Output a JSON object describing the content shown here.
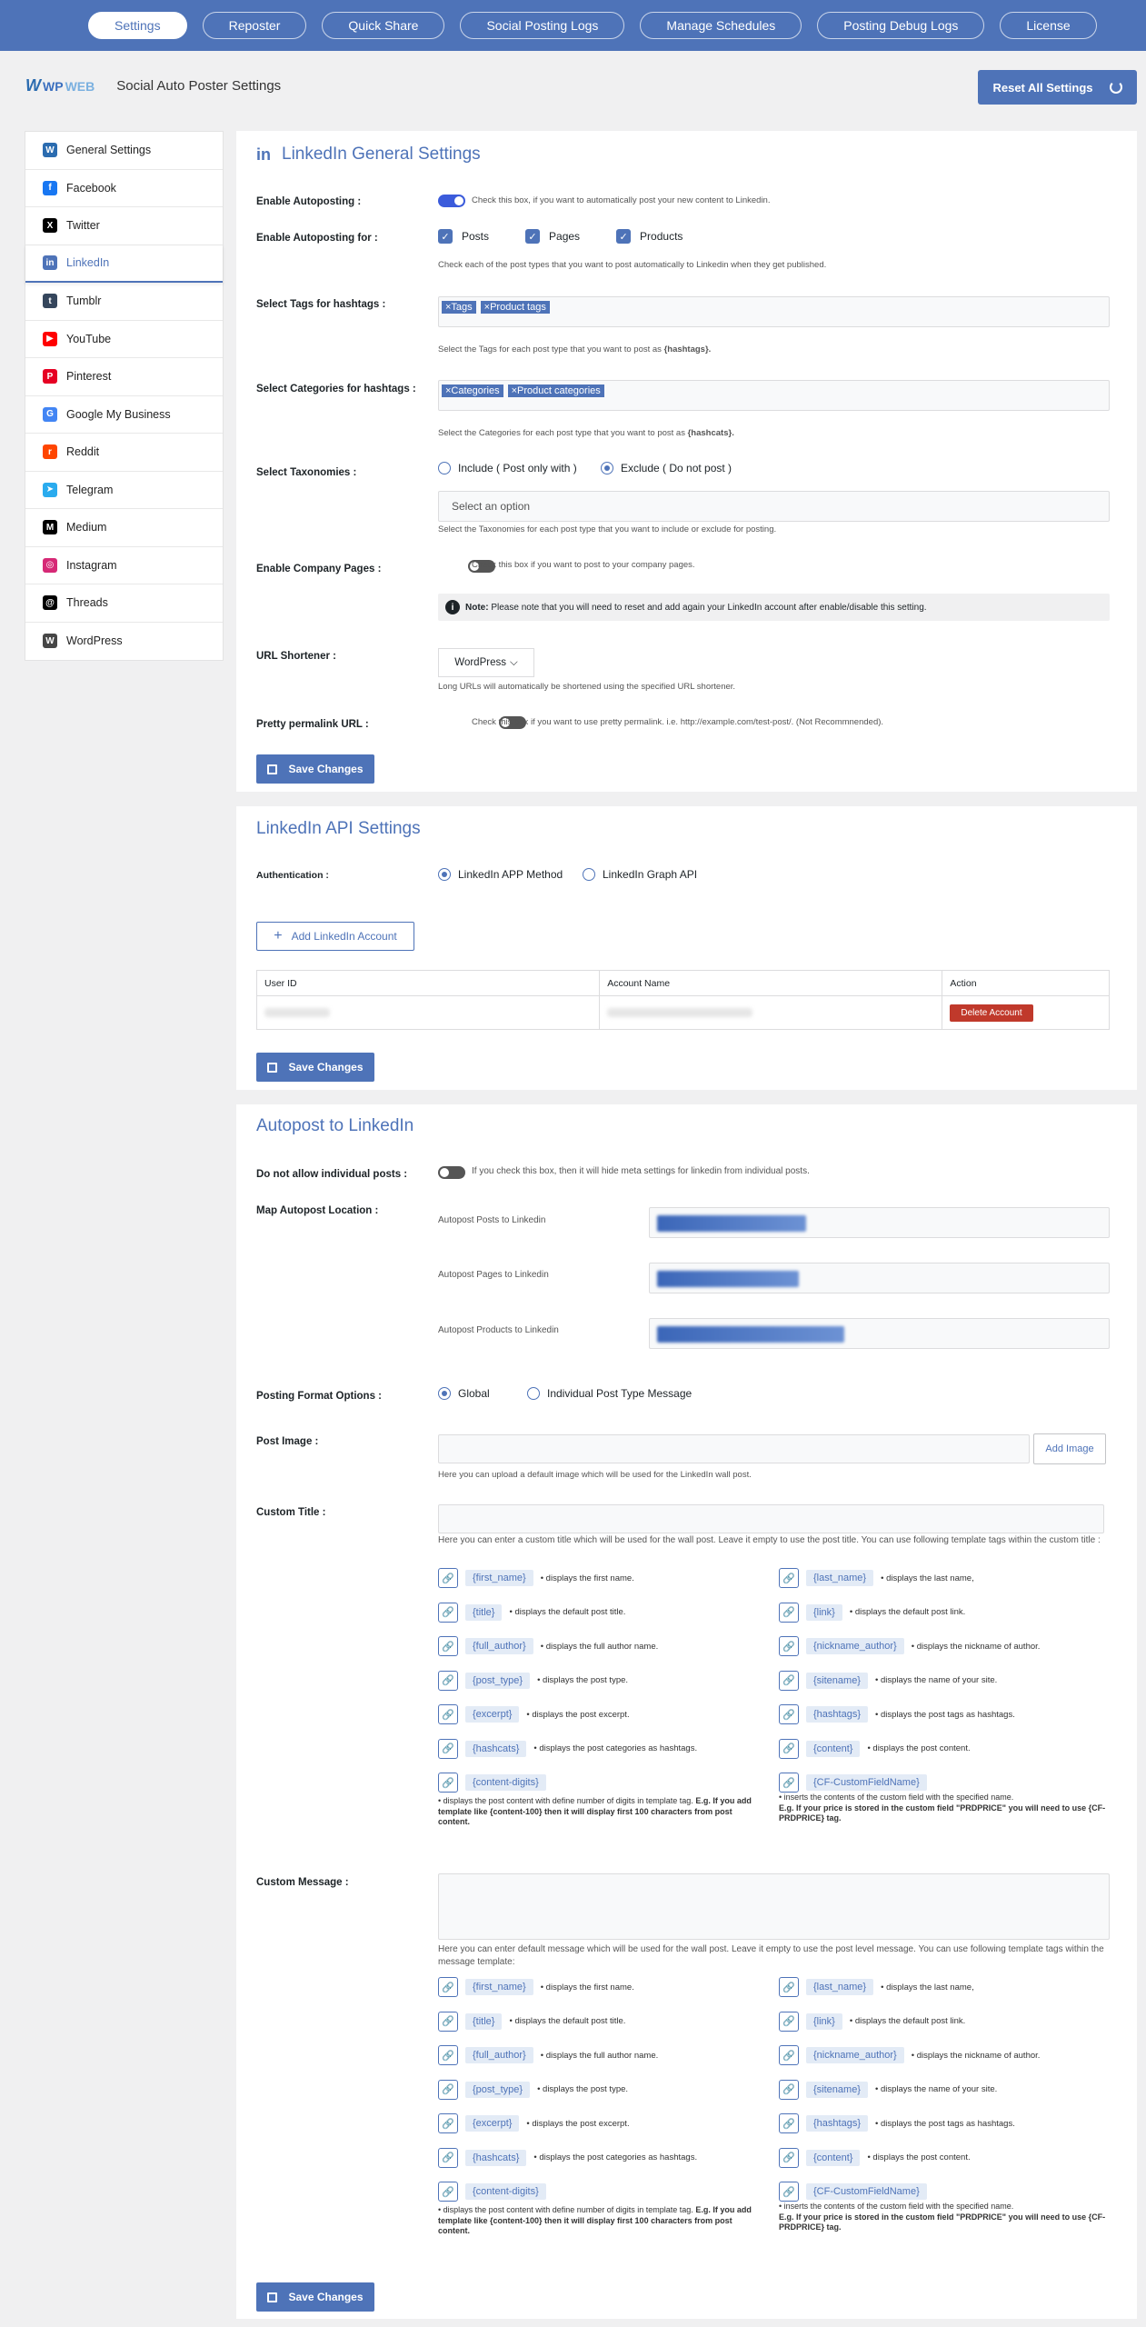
{
  "top_tabs": [
    "Settings",
    "Reposter",
    "Quick Share",
    "Social Posting Logs",
    "Manage Schedules",
    "Posting Debug Logs",
    "License"
  ],
  "brand": {
    "logo_w": "W",
    "logo_wp": "WP",
    "logo_web": "WEB",
    "title": "Social Auto Poster Settings"
  },
  "reset_button": "Reset All Settings",
  "sidebar": [
    {
      "label": "General Settings",
      "icon": "wpweb-icon",
      "color": "#2b6cb0",
      "glyph": "W"
    },
    {
      "label": "Facebook",
      "icon": "facebook-icon",
      "color": "#1877f2",
      "glyph": "f"
    },
    {
      "label": "Twitter",
      "icon": "x-icon",
      "color": "#000000",
      "glyph": "X"
    },
    {
      "label": "LinkedIn",
      "icon": "linkedin-icon",
      "color": "#4e73b8",
      "glyph": "in"
    },
    {
      "label": "Tumblr",
      "icon": "tumblr-icon",
      "color": "#35465c",
      "glyph": "t"
    },
    {
      "label": "YouTube",
      "icon": "youtube-icon",
      "color": "#ff0000",
      "glyph": "▶"
    },
    {
      "label": "Pinterest",
      "icon": "pinterest-icon",
      "color": "#e60023",
      "glyph": "P"
    },
    {
      "label": "Google My Business",
      "icon": "gmb-icon",
      "color": "#4285f4",
      "glyph": "G"
    },
    {
      "label": "Reddit",
      "icon": "reddit-icon",
      "color": "#ff4500",
      "glyph": "r"
    },
    {
      "label": "Telegram",
      "icon": "telegram-icon",
      "color": "#2aabee",
      "glyph": "➤"
    },
    {
      "label": "Medium",
      "icon": "medium-icon",
      "color": "#000000",
      "glyph": "M"
    },
    {
      "label": "Instagram",
      "icon": "instagram-icon",
      "color": "#d62976",
      "glyph": "◎"
    },
    {
      "label": "Threads",
      "icon": "threads-icon",
      "color": "#000000",
      "glyph": "@"
    },
    {
      "label": "WordPress",
      "icon": "wordpress-icon",
      "color": "#464646",
      "glyph": "W"
    }
  ],
  "general": {
    "title": "LinkedIn General Settings",
    "enable_autoposting_label": "Enable Autoposting :",
    "enable_autoposting_hint": "Check this box, if you want to automatically post your new content to Linkedin.",
    "enable_for_label": "Enable Autoposting for :",
    "post_types": [
      "Posts",
      "Pages",
      "Products"
    ],
    "enable_for_hint": "Check each of the post types that you want to post automatically to Linkedin when they get published.",
    "tags_label": "Select Tags for hashtags :",
    "tags_chips": [
      "×Tags",
      "×Product tags"
    ],
    "tags_hint_a": "Select the Tags for each post type that you want to post as ",
    "tags_hint_b": "{hashtags}.",
    "cats_label": "Select Categories for hashtags :",
    "cats_chips": [
      "×Categories",
      "×Product categories"
    ],
    "cats_hint_a": "Select the Categories for each post type that you want to post as ",
    "cats_hint_b": "{hashcats}.",
    "tax_label": "Select Taxonomies :",
    "tax_include": "Include ( Post only with )",
    "tax_exclude": "Exclude ( Do not post )",
    "tax_placeholder": "Select an option",
    "tax_hint": "Select the Taxonomies for each post type that you want to include or exclude for posting.",
    "company_label": "Enable Company Pages :",
    "company_hint": "Check this box if you want to post to your company pages.",
    "note_bold": "Note:",
    "note_text": " Please note that you will need to reset and add again your LinkedIn account after enable/disable this setting.",
    "shortener_label": "URL Shortener :",
    "shortener_value": "WordPress",
    "shortener_hint": "Long URLs will automatically be shortened using the specified URL shortener.",
    "permalink_label": "Pretty permalink URL :",
    "permalink_hint": "Check this box if you want to use pretty permalink. i.e. http://example.com/test-post/. (Not Recommnended).",
    "save": "Save Changes"
  },
  "api": {
    "title": "LinkedIn API Settings",
    "auth_label": "Authentication :",
    "method_app": "LinkedIn APP Method",
    "method_graph": "LinkedIn Graph API",
    "add_account": "Add LinkedIn Account",
    "columns": [
      "User ID",
      "Account Name",
      "Action"
    ],
    "delete": "Delete Account",
    "save": "Save Changes"
  },
  "autopost": {
    "title": "Autopost to LinkedIn",
    "no_individual_label": "Do not allow individual posts :",
    "no_individual_hint": "If you check this box, then it will hide meta settings for linkedin from individual posts.",
    "map_label": "Map Autopost Location :",
    "map_rows": [
      "Autopost Posts to Linkedin",
      "Autopost Pages to Linkedin",
      "Autopost Products to Linkedin"
    ],
    "format_label": "Posting Format Options :",
    "format_global": "Global",
    "format_individual": "Individual Post Type Message",
    "image_label": "Post Image :",
    "add_image": "Add Image",
    "image_hint": "Here you can upload a default image which will be used for the LinkedIn wall post.",
    "title_label": "Custom Title :",
    "title_hint": "Here you can enter a custom title which will be used for the wall post. Leave it empty to use the post title. You can use following template tags within the custom title :",
    "message_label": "Custom Message :",
    "message_hint": "Here you can enter default message which will be used for the wall post. Leave it empty to use the post level message. You can use following template tags within the message template:",
    "tags_left": [
      {
        "code": "{first_name}",
        "desc": "displays the first name."
      },
      {
        "code": "{title}",
        "desc": "displays the default post title."
      },
      {
        "code": "{full_author}",
        "desc": "displays the full author name."
      },
      {
        "code": "{post_type}",
        "desc": "displays the post type."
      },
      {
        "code": "{excerpt}",
        "desc": "displays the post excerpt."
      },
      {
        "code": "{hashcats}",
        "desc": "displays the post categories as hashtags."
      },
      {
        "code": "{content-digits}",
        "desc": ""
      }
    ],
    "tags_right": [
      {
        "code": "{last_name}",
        "desc": "displays the last name,"
      },
      {
        "code": "{link}",
        "desc": "displays the default post link."
      },
      {
        "code": "{nickname_author}",
        "desc": "displays the nickname of author."
      },
      {
        "code": "{sitename}",
        "desc": "displays the name of your site."
      },
      {
        "code": "{hashtags}",
        "desc": "displays the post tags as hashtags."
      },
      {
        "code": "{content}",
        "desc": "displays the post content."
      },
      {
        "code": "{CF-CustomFieldName}",
        "desc": ""
      }
    ],
    "digits_note_a": "• displays the post content with define number of digits in template tag. ",
    "digits_note_b": "E.g. If you add template like {content-100} then it will display first 100 characters from post content.",
    "cf_note_a": "• inserts the contents of the custom field with the specified name.",
    "cf_note_b": "E.g. If your price is stored in the custom field \"PRDPRICE\" you will need to use {CF-PRDPRICE} tag.",
    "save": "Save Changes"
  }
}
